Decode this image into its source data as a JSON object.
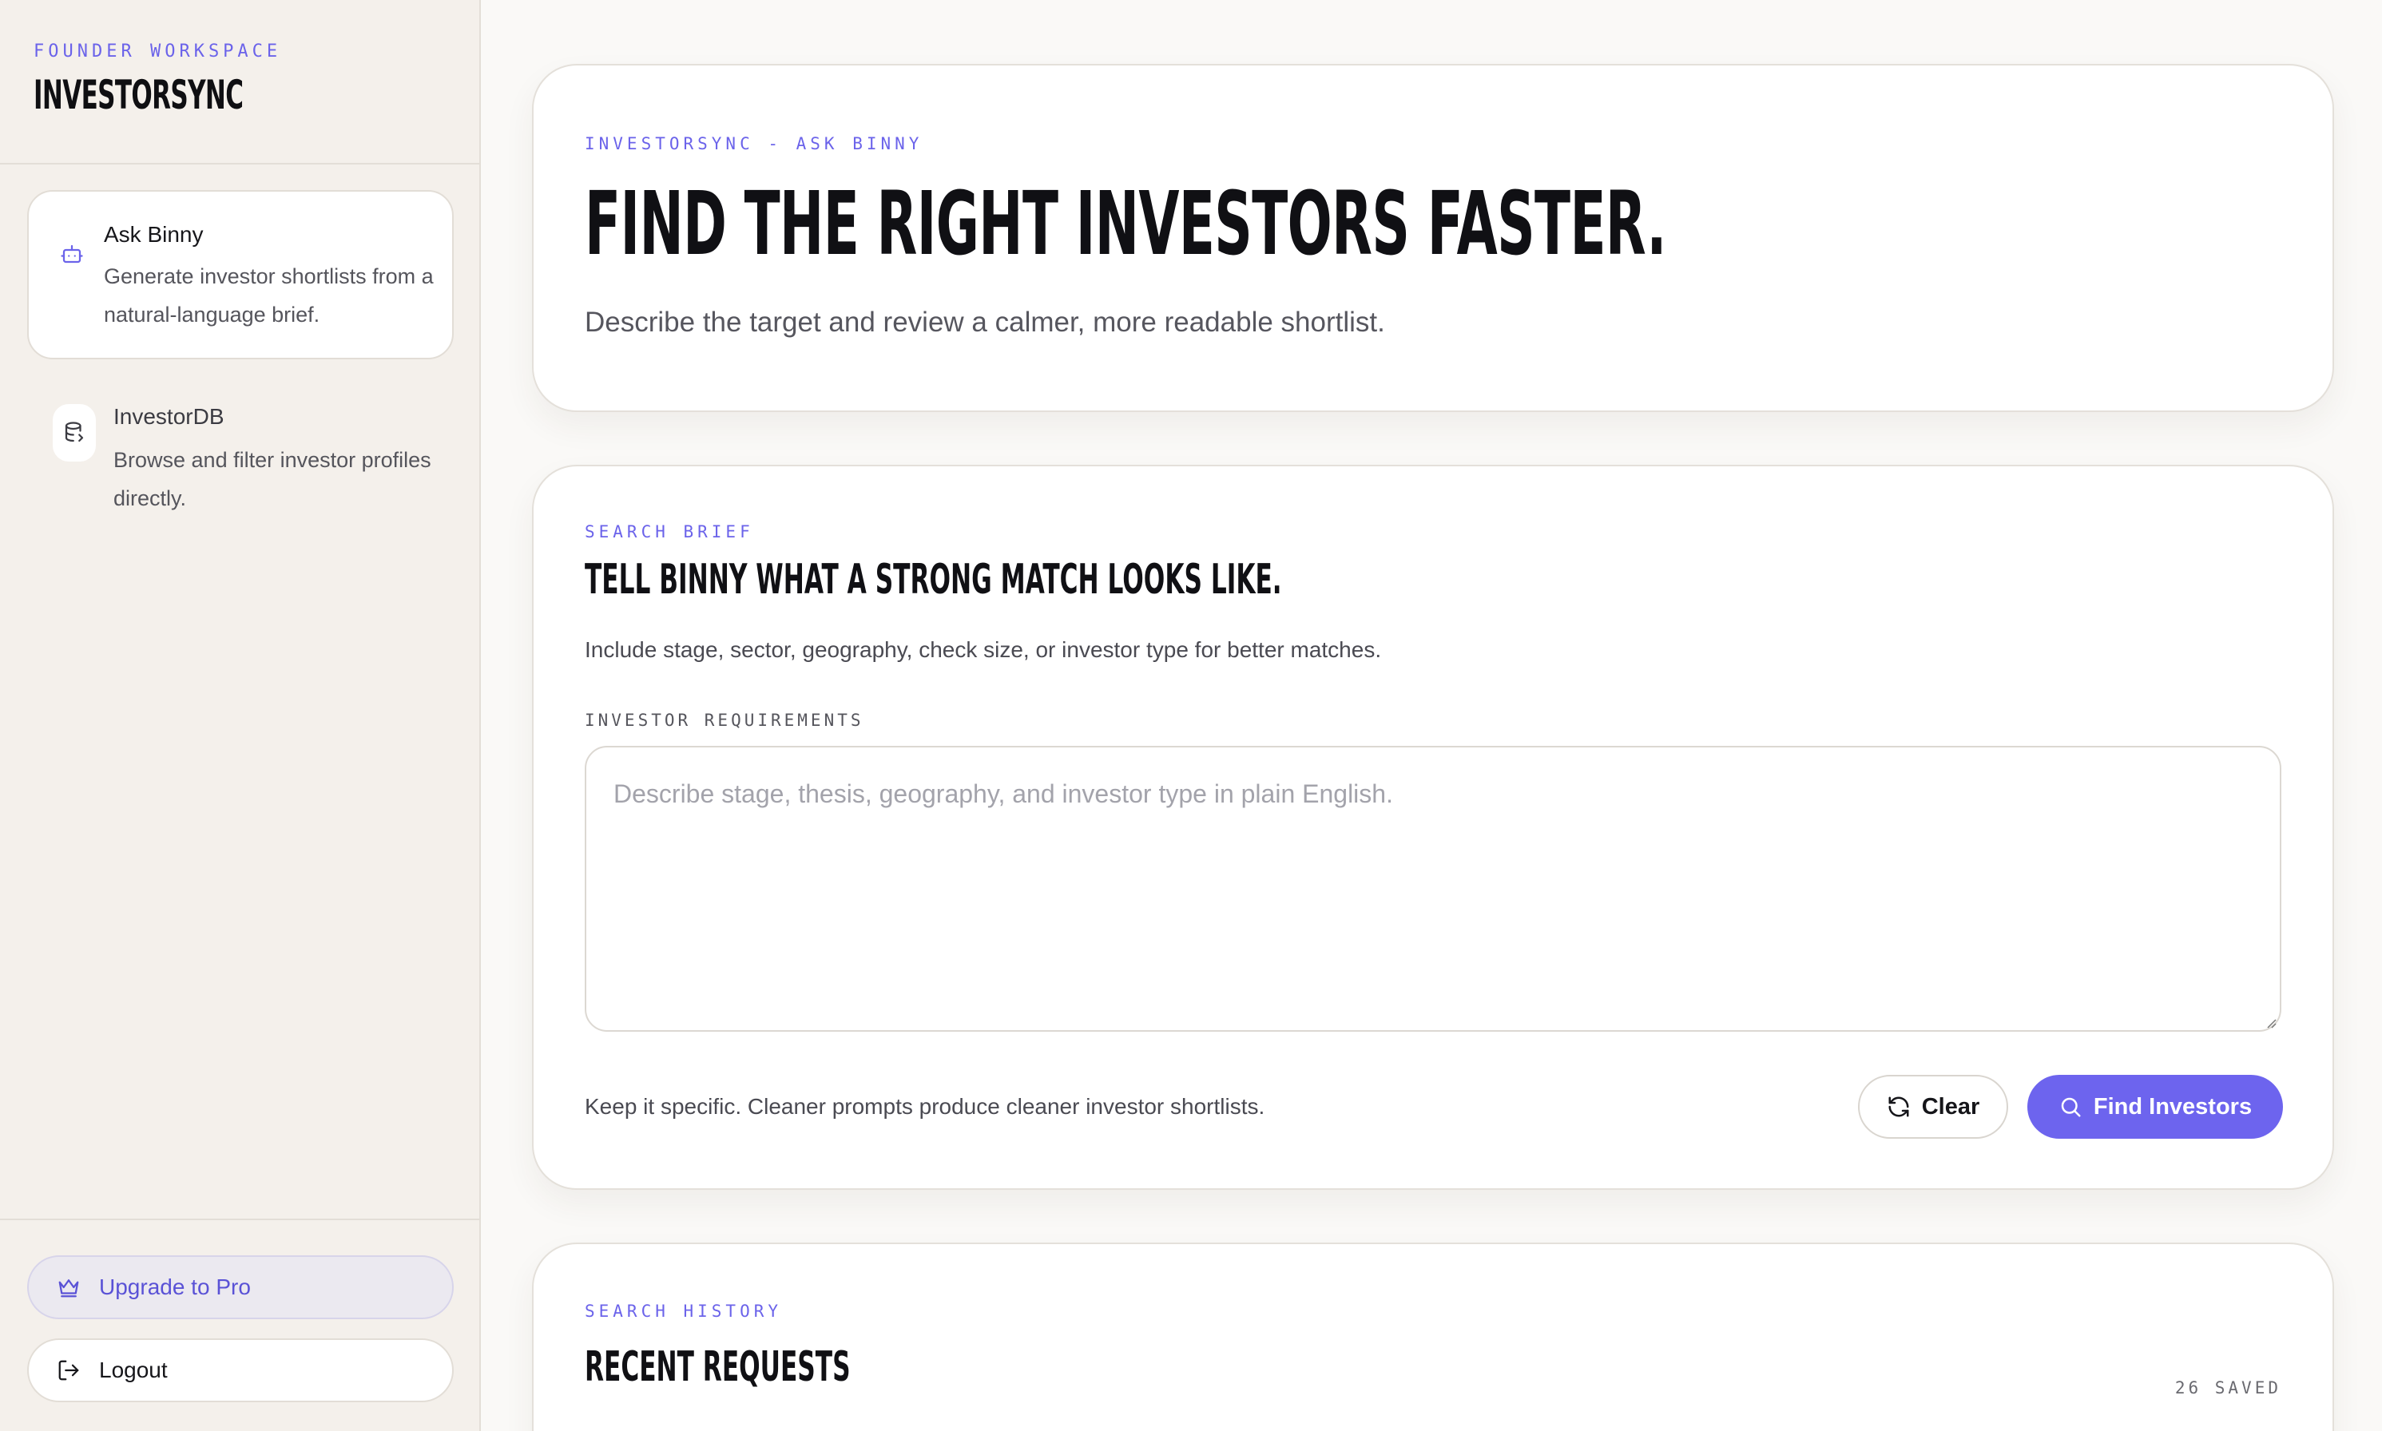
{
  "sidebar": {
    "workspace_label": "FOUNDER WORKSPACE",
    "brand": "INVESTORSYNC",
    "nav": [
      {
        "title": "Ask Binny",
        "description": "Generate investor shortlists from a natural-language brief.",
        "icon": "bot-icon",
        "active": true
      },
      {
        "title": "InvestorDB",
        "description": "Browse and filter investor profiles directly.",
        "icon": "database-icon",
        "active": false
      }
    ],
    "upgrade_label": "Upgrade to Pro",
    "logout_label": "Logout"
  },
  "hero": {
    "eyebrow": "INVESTORSYNC - ASK BINNY",
    "title": "FIND THE RIGHT INVESTORS FASTER.",
    "subtitle": "Describe the target and review a calmer, more readable shortlist."
  },
  "search": {
    "eyebrow": "SEARCH BRIEF",
    "title": "TELL BINNY WHAT A STRONG MATCH LOOKS LIKE.",
    "description": "Include stage, sector, geography, check size, or investor type for better matches.",
    "field_label": "INVESTOR REQUIREMENTS",
    "value": "",
    "placeholder": "Describe stage, thesis, geography, and investor type in plain English.",
    "hint": "Keep it specific. Cleaner prompts produce cleaner investor shortlists.",
    "clear_label": "Clear",
    "find_label": "Find Investors"
  },
  "history": {
    "eyebrow": "SEARCH HISTORY",
    "title": "RECENT REQUESTS",
    "saved_count": "26 SAVED"
  },
  "colors": {
    "accent": "#6d64ee",
    "sidebar_bg": "#f4f0eb",
    "page_bg": "#faf9f7"
  }
}
